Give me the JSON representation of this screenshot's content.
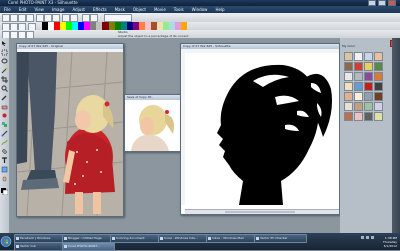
{
  "window": {
    "title": "Corel PHOTO-PAINT X3 - Silhouette",
    "menus": [
      "File",
      "Edit",
      "View",
      "Image",
      "Adjust",
      "Effects",
      "Mask",
      "Object",
      "Movie",
      "Tools",
      "Window",
      "Help"
    ]
  },
  "toolbar": {
    "style_label": "Studio",
    "style_hint": "Adjust the object to a percentage of its current"
  },
  "palette": [
    "#000000",
    "#ffffff",
    "#ff0000",
    "#ffff00",
    "#00ff00",
    "#00ffff",
    "#0000ff",
    "#ff00ff",
    "#808080",
    "#c0c0c0",
    "#800000",
    "#808000",
    "#008000",
    "#008080",
    "#000080",
    "#800080",
    "#ff8040",
    "#ffc0cb",
    "#a0522d",
    "#f5deb3",
    "#90ee90",
    "#add8e6",
    "#dda0dd",
    "#ffa500"
  ],
  "documents": {
    "doc1_title": "Copy of 07 Wiz 625 - Original",
    "doc2_title": "Save of Copy 0f...",
    "doc3_title": "Copy of 07 Wiz 625 - Silhouette"
  },
  "right_panel": {
    "title": "My Color"
  },
  "taskbar": {
    "start_label": "Start",
    "items": [
      {
        "label": "Facebook | Windows"
      },
      {
        "label": "Blogger: Untitled Page"
      },
      {
        "label": "Coloring document"
      },
      {
        "label": "Corel - Windows Inte..."
      },
      {
        "label": "Inbox - Windows Mail"
      },
      {
        "label": "Vector PC Checker"
      },
      {
        "label": "Vector Cut"
      },
      {
        "label": "Corel PHOTO-PAINT..."
      }
    ],
    "clock_time": "1:38 PM",
    "clock_day": "Thursday",
    "clock_date": "3/1/2012"
  }
}
